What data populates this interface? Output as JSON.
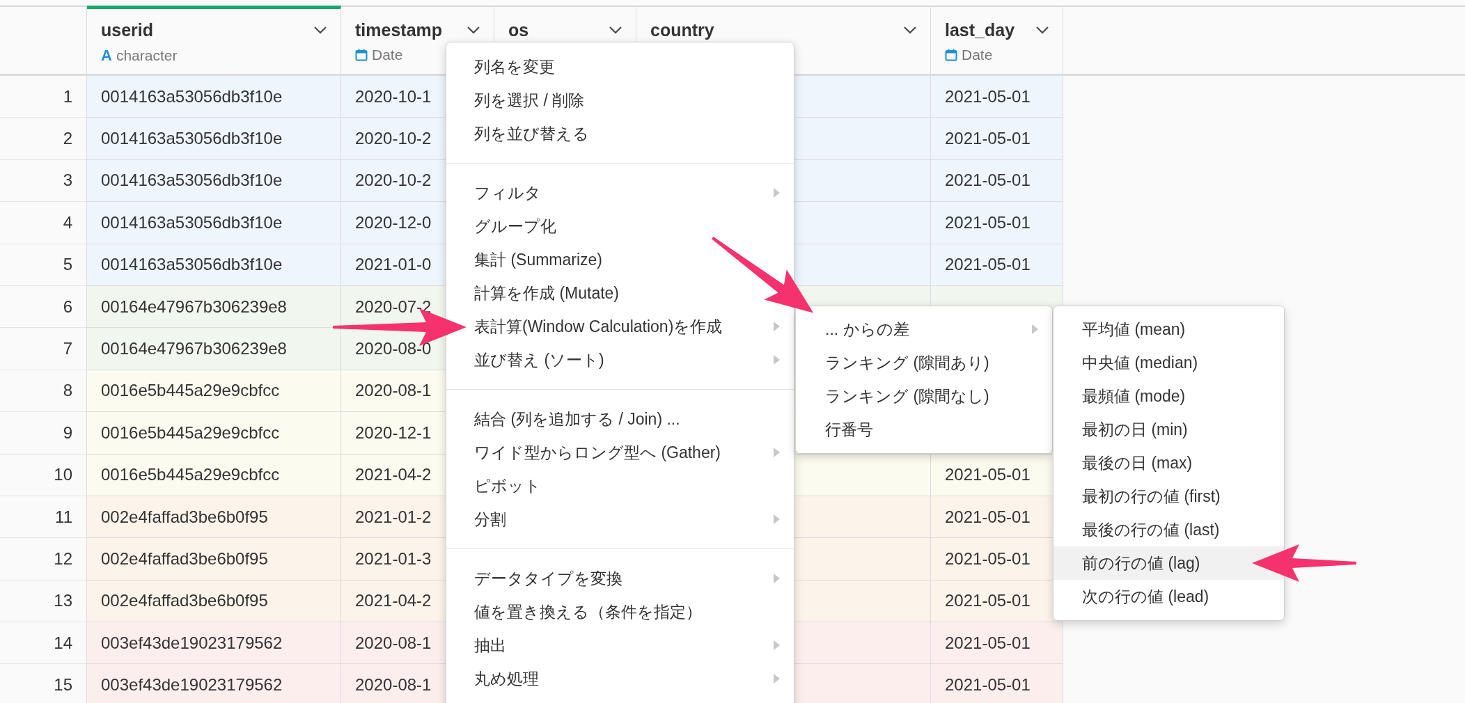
{
  "columns": [
    {
      "name": "userid",
      "kind": "character",
      "glyph": "A",
      "type": "character",
      "selected": true
    },
    {
      "name": "timestamp",
      "kind": "date",
      "type": "Date",
      "selected": false
    },
    {
      "name": "os",
      "selected": false
    },
    {
      "name": "country",
      "selected": false
    },
    {
      "name": "last_day",
      "kind": "date",
      "type": "Date",
      "selected": false
    }
  ],
  "rows": [
    {
      "num": "1",
      "userid": "0014163a53056db3f10e",
      "timestamp": "2020-10-1",
      "last_day": "2021-05-01",
      "color": "#eef5fd"
    },
    {
      "num": "2",
      "userid": "0014163a53056db3f10e",
      "timestamp": "2020-10-2",
      "last_day": "2021-05-01",
      "color": "#eef5fd"
    },
    {
      "num": "3",
      "userid": "0014163a53056db3f10e",
      "timestamp": "2020-10-2",
      "last_day": "2021-05-01",
      "color": "#eef5fd"
    },
    {
      "num": "4",
      "userid": "0014163a53056db3f10e",
      "timestamp": "2020-12-0",
      "last_day": "2021-05-01",
      "color": "#eef5fd"
    },
    {
      "num": "5",
      "userid": "0014163a53056db3f10e",
      "timestamp": "2021-01-0",
      "last_day": "2021-05-01",
      "color": "#eef5fd"
    },
    {
      "num": "6",
      "userid": "00164e47967b306239e8",
      "timestamp": "2020-07-2",
      "color": "#f1f7ee"
    },
    {
      "num": "7",
      "userid": "00164e47967b306239e8",
      "timestamp": "2020-08-0",
      "color": "#f1f7ee"
    },
    {
      "num": "8",
      "userid": "0016e5b445a29e9cbfcc",
      "timestamp": "2020-08-1",
      "color": "#fbfbf0"
    },
    {
      "num": "9",
      "userid": "0016e5b445a29e9cbfcc",
      "timestamp": "2020-12-1",
      "color": "#fbfbf0"
    },
    {
      "num": "10",
      "userid": "0016e5b445a29e9cbfcc",
      "timestamp": "2021-04-2",
      "last_day": "2021-05-01",
      "color": "#fbfbf0"
    },
    {
      "num": "11",
      "userid": "002e4faffad3be6b0f95",
      "timestamp": "2021-01-2",
      "last_day": "2021-05-01",
      "color": "#fcf3ea"
    },
    {
      "num": "12",
      "userid": "002e4faffad3be6b0f95",
      "timestamp": "2021-01-3",
      "last_day": "2021-05-01",
      "color": "#fcf3ea"
    },
    {
      "num": "13",
      "userid": "002e4faffad3be6b0f95",
      "timestamp": "2021-04-2",
      "last_day": "2021-05-01",
      "color": "#fcf3ea"
    },
    {
      "num": "14",
      "userid": "003ef43de19023179562",
      "timestamp": "2020-08-1",
      "last_day": "2021-05-01",
      "color": "#fdeeee"
    },
    {
      "num": "15",
      "userid": "003ef43de19023179562",
      "timestamp": "2020-08-1",
      "last_day": "2021-05-01",
      "color": "#fdeeee"
    }
  ],
  "context_menu": {
    "sections": [
      [
        {
          "label": "列名を変更",
          "submenu": false
        },
        {
          "label": "列を選択 / 削除",
          "submenu": false
        },
        {
          "label": "列を並び替える",
          "submenu": false
        }
      ],
      [
        {
          "label": "フィルタ",
          "submenu": true
        },
        {
          "label": "グループ化",
          "submenu": false
        },
        {
          "label": "集計 (Summarize)",
          "submenu": false
        },
        {
          "label": "計算を作成 (Mutate)",
          "submenu": false
        },
        {
          "label": "表計算(Window Calculation)を作成",
          "submenu": true
        },
        {
          "label": "並び替え (ソート)",
          "submenu": true
        }
      ],
      [
        {
          "label": "結合 (列を追加する / Join) ...",
          "submenu": false
        },
        {
          "label": "ワイド型からロング型へ (Gather)",
          "submenu": true
        },
        {
          "label": "ピボット",
          "submenu": false
        },
        {
          "label": "分割",
          "submenu": true
        }
      ],
      [
        {
          "label": "データタイプを変換",
          "submenu": true
        },
        {
          "label": "値を置き換える（条件を指定）",
          "submenu": false
        },
        {
          "label": "抽出",
          "submenu": true
        },
        {
          "label": "丸め処理",
          "submenu": true
        }
      ]
    ]
  },
  "window_calc_menu": {
    "items": [
      {
        "label": "... からの差",
        "submenu": true
      },
      {
        "label": "ランキング (隙間あり)",
        "submenu": false
      },
      {
        "label": "ランキング (隙間なし)",
        "submenu": false
      },
      {
        "label": "行番号",
        "submenu": false
      }
    ]
  },
  "difference_menu": {
    "items": [
      {
        "label": "平均値 (mean)",
        "selected": false
      },
      {
        "label": "中央値 (median)",
        "selected": false
      },
      {
        "label": "最頻値 (mode)",
        "selected": false
      },
      {
        "label": "最初の日 (min)",
        "selected": false
      },
      {
        "label": "最後の日 (max)",
        "selected": false
      },
      {
        "label": "最初の行の値 (first)",
        "selected": false
      },
      {
        "label": "最後の行の値 (last)",
        "selected": false
      },
      {
        "label": "前の行の値 (lag)",
        "selected": true
      },
      {
        "label": "次の行の値 (lead)",
        "selected": false
      }
    ]
  }
}
